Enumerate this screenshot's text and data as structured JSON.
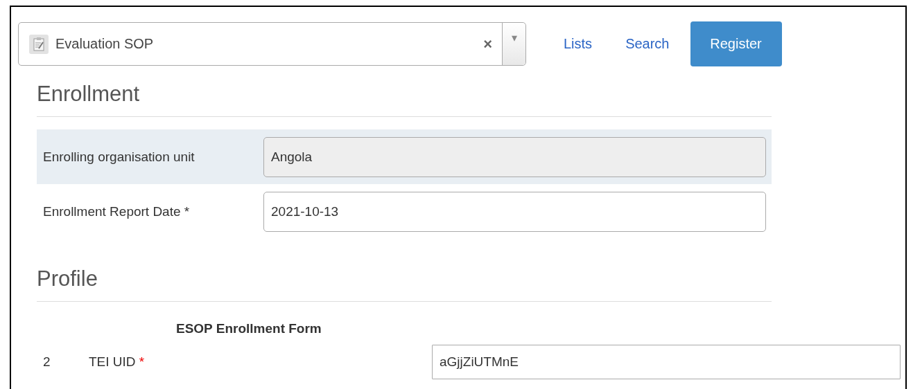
{
  "program_select": {
    "value": "Evaluation SOP",
    "clear": "×",
    "caret": "▾"
  },
  "nav": [
    {
      "label": "Lists",
      "kind": "link"
    },
    {
      "label": "Search",
      "kind": "link"
    },
    {
      "label": "Register",
      "kind": "primary"
    }
  ],
  "enrollment": {
    "heading": "Enrollment",
    "fields": [
      {
        "label": "Enrolling organisation unit",
        "value": "Angola",
        "disabled": true,
        "highlighted": true
      },
      {
        "label": "Enrollment Report Date *",
        "value": "2021-10-13",
        "disabled": false,
        "highlighted": false
      }
    ]
  },
  "profile": {
    "heading": "Profile",
    "form_title": "ESOP Enrollment Form",
    "rows": [
      {
        "number": "2",
        "label": "TEI UID",
        "required_mark": "*",
        "value": "aGjjZiUTMnE"
      }
    ]
  }
}
